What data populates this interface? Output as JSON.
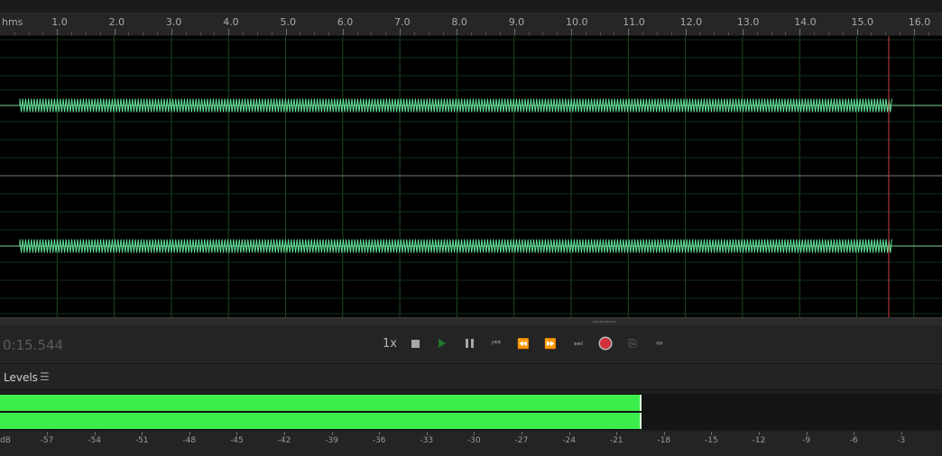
{
  "ruler": {
    "unit": "hms",
    "ticks": [
      "1.0",
      "2.0",
      "3.0",
      "4.0",
      "5.0",
      "6.0",
      "7.0",
      "8.0",
      "9.0",
      "10.0",
      "11.0",
      "12.0",
      "13.0",
      "14.0",
      "15.0",
      "16.0"
    ]
  },
  "waveform": {
    "wave_color": "#63e39a",
    "playhead_color": "#d0404a",
    "grid_color": "#1e4a22"
  },
  "transport": {
    "timecode": "0:15.544",
    "speed": "1x",
    "buttons": [
      {
        "name": "stop-icon",
        "label": "stop"
      },
      {
        "name": "play-icon",
        "label": "play"
      },
      {
        "name": "pause-icon",
        "label": "pause"
      },
      {
        "name": "skip-to-start-icon",
        "label": "move playhead to previous"
      },
      {
        "name": "rewind-icon",
        "label": "rewind"
      },
      {
        "name": "fast-forward-icon",
        "label": "fast forward"
      },
      {
        "name": "skip-to-end-icon",
        "label": "move playhead to next"
      },
      {
        "name": "record-icon",
        "label": "record"
      },
      {
        "name": "loop-icon",
        "label": "loop playback"
      },
      {
        "name": "skip-selection-icon",
        "label": "skip selection"
      }
    ]
  },
  "levels": {
    "title": "Levels",
    "menu_icon": "hamburger-menu-icon",
    "level_db": -19.5,
    "peak_db": -19.5,
    "meter_color": "#3cee4b",
    "scale": [
      "dB",
      "-57",
      "-54",
      "-51",
      "-48",
      "-45",
      "-42",
      "-39",
      "-36",
      "-33",
      "-30",
      "-27",
      "-24",
      "-21",
      "-18",
      "-15",
      "-12",
      "-9",
      "-6",
      "-3"
    ]
  }
}
